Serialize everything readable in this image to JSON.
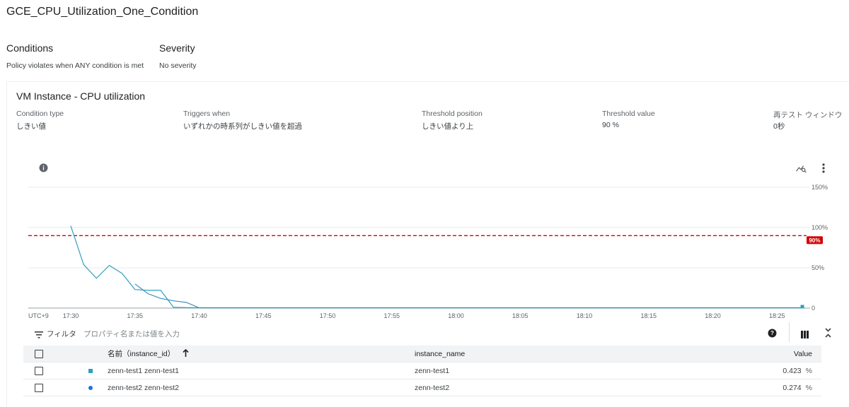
{
  "page": {
    "title": "GCE_CPU_Utilization_One_Condition"
  },
  "summary": {
    "conditions_heading": "Conditions",
    "conditions_text": "Policy violates when ANY condition is met",
    "severity_heading": "Severity",
    "severity_text": "No severity"
  },
  "condition_card": {
    "title": "VM Instance - CPU utilization",
    "details": [
      {
        "label": "Condition type",
        "value": "しきい値"
      },
      {
        "label": "Triggers when",
        "value": "いずれかの時系列がしきい値を超過"
      },
      {
        "label": "Threshold position",
        "value": "しきい値より上"
      },
      {
        "label": "Threshold value",
        "value": "90 %"
      },
      {
        "label": "再テスト ウィンドウ",
        "value": "0秒"
      }
    ]
  },
  "icons": {
    "info": "info-icon",
    "explore": "explore-chart-icon",
    "more": "more-vert-icon",
    "filter": "filter-icon",
    "help": "help-icon",
    "columns": "column-display-icon",
    "collapse": "collapse-icon",
    "sort": "arrow-up-icon"
  },
  "colors": {
    "threshold": "#d50000",
    "series1": "#2f9fbf",
    "series2": "#1a73e8",
    "grid": "#e8eaed"
  },
  "chart_data": {
    "type": "line",
    "timezone_label": "UTC+9",
    "x_ticks": [
      "17:30",
      "17:35",
      "17:40",
      "17:45",
      "17:50",
      "17:55",
      "18:00",
      "18:05",
      "18:10",
      "18:15",
      "18:20",
      "18:25"
    ],
    "y_ticks": [
      "150%",
      "100%",
      "50%",
      "0"
    ],
    "ylim": [
      0,
      150
    ],
    "threshold": {
      "value": 90,
      "label": "90%"
    },
    "series": [
      {
        "name": "zenn-test1 zenn-test1",
        "marker": "square",
        "points": [
          [
            "17:30",
            102
          ],
          [
            "17:31",
            54
          ],
          [
            "17:32",
            37
          ],
          [
            "17:33",
            53
          ],
          [
            "17:34",
            43
          ],
          [
            "17:35",
            23
          ],
          [
            "17:36",
            22
          ],
          [
            "17:37",
            22
          ],
          [
            "17:38",
            1
          ],
          [
            "17:39",
            0.5
          ],
          [
            "17:40",
            0.4
          ],
          [
            "18:27",
            0.423
          ]
        ]
      },
      {
        "name": "zenn-test2 zenn-test2",
        "marker": "circle",
        "points": [
          [
            "17:35",
            30
          ],
          [
            "17:36",
            18
          ],
          [
            "17:37",
            12
          ],
          [
            "17:38",
            9
          ],
          [
            "17:39",
            7
          ],
          [
            "17:40",
            0.3
          ],
          [
            "18:27",
            0.274
          ]
        ]
      }
    ]
  },
  "filter": {
    "label": "フィルタ",
    "placeholder": "プロパティ名または値を入力"
  },
  "table": {
    "headers": {
      "name": "名前（instance_id）",
      "instance_name": "instance_name",
      "value": "Value"
    },
    "rows": [
      {
        "name": "zenn-test1 zenn-test1",
        "instance_name": "zenn-test1",
        "value": "0.423",
        "unit": "%"
      },
      {
        "name": "zenn-test2 zenn-test2",
        "instance_name": "zenn-test2",
        "value": "0.274",
        "unit": "%"
      }
    ]
  }
}
